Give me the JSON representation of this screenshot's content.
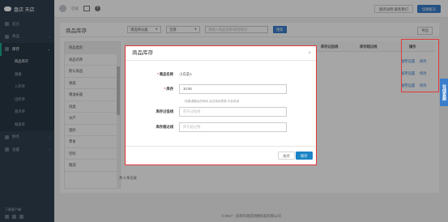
{
  "brand": {
    "name": "盘店 天店"
  },
  "sidebar": {
    "items": [
      {
        "label": "首页",
        "icon": "home-icon"
      },
      {
        "label": "商品",
        "icon": "goods-icon"
      },
      {
        "label": "库存",
        "icon": "stock-icon"
      }
    ],
    "sub_items": [
      "商品库存",
      "调拨",
      "入库单",
      "出库单",
      "盘点单",
      "报损单"
    ],
    "more_items": [
      {
        "label": "财务",
        "icon": "finance-icon"
      },
      {
        "label": "设置",
        "icon": "settings-icon"
      }
    ],
    "footer_label": "下载客户端"
  },
  "topbar": {
    "user": "店铺",
    "btn_left": "服务说明  联系我们",
    "btn_right": "切换账号"
  },
  "panel": {
    "title": "商品库存",
    "select_category": "请选择分类",
    "select_all": "全部",
    "search_placeholder": "请输入商品名称/拼音缩写",
    "search_btn": "搜索",
    "export_btn": "导出",
    "categories": [
      "商品类别",
      "商品名称",
      "默认商品",
      "果蔬",
      "粮油米面",
      "肉类",
      "水产",
      "蛋奶",
      "零食",
      "饮料",
      "烟酒"
    ],
    "columns": {
      "warn_low": "库存过低线",
      "warn_high": "库存超过线",
      "op": "操作"
    },
    "op_links": [
      "报警设置",
      "修改"
    ],
    "footer_count": "共 3 条记录"
  },
  "copyright": "© 2017 - 深圳市盘店网络科技有限公司",
  "side_tab": "在线客服",
  "modal": {
    "title": "商品库存",
    "close": "×",
    "rows": [
      {
        "label": "商品名称",
        "value": "小白菜A",
        "required": true
      },
      {
        "label": "库存",
        "value": "10.00",
        "required": true
      },
      {
        "label": "库存过低线",
        "placeholder": "库存过低线"
      },
      {
        "label": "库存超过线",
        "placeholder": "库存超过线"
      }
    ],
    "required_mark": "*",
    "help": "*如果调整后的库存,会在库存表里,不会有减",
    "cancel": "关闭",
    "save": "保存"
  },
  "colors": {
    "accent": "#3a7ecb",
    "highlight": "#e03a3a",
    "sidebar": "#2f4050"
  }
}
